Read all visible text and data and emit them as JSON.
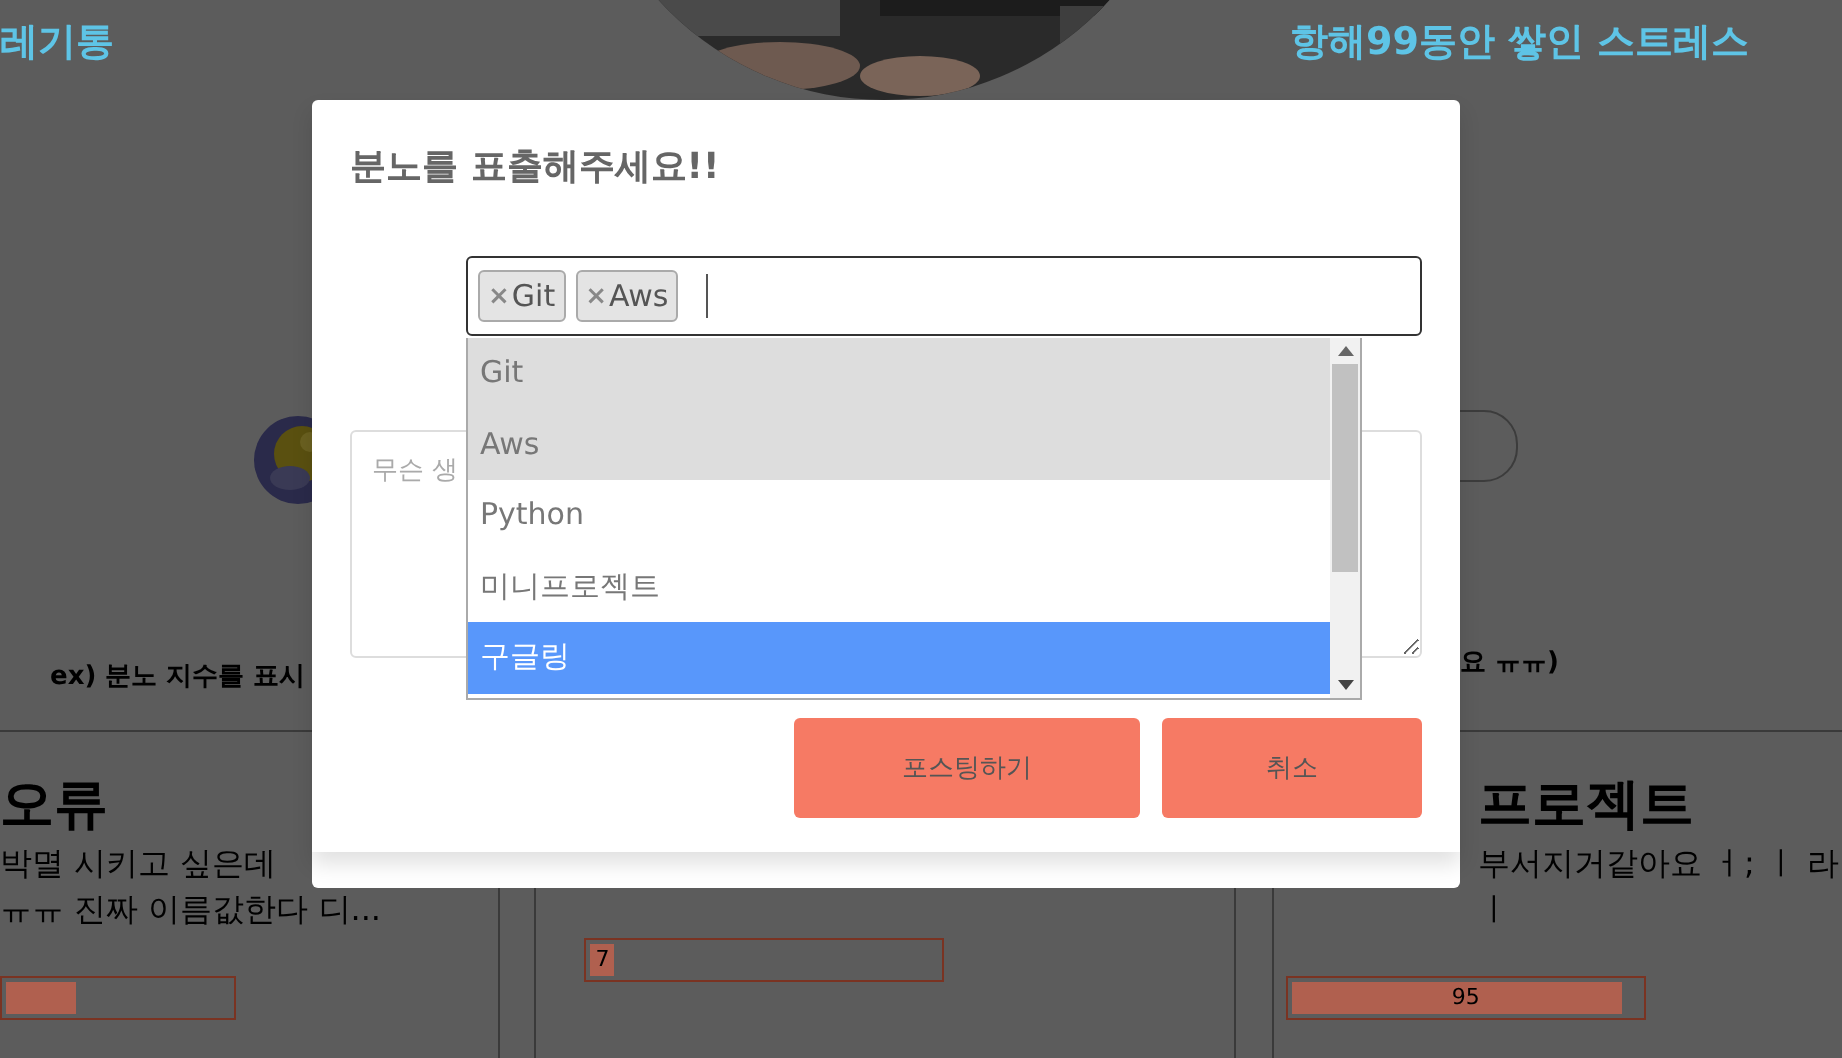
{
  "page": {
    "left_heading": "레기통",
    "right_heading": "항해99동안 쌓인 스트레스",
    "left_caption": "ex) 분노 지수를 표시",
    "right_caption": "요 ㅠㅠ)",
    "cards": [
      {
        "title": "오류",
        "lines": [
          "박멸 시키고 싶은데",
          "ㅠㅠ 진짜 이름값한다 디..."
        ],
        "level": 0.31
      },
      {
        "level": 0.07,
        "reading": "7"
      },
      {
        "title": "프로젝트",
        "lines": [
          "부서지거같아요 ㅓ; ㅣ 라",
          "ㅣ"
        ],
        "level": 0.95,
        "reading": "95"
      }
    ]
  },
  "modal": {
    "title": "분노를 표출해주세요!!",
    "tags": [
      {
        "remove": "×",
        "label": "Git"
      },
      {
        "remove": "×",
        "label": "Aws"
      }
    ],
    "options": [
      {
        "label": "Git",
        "selected": true,
        "highlighted": false
      },
      {
        "label": "Aws",
        "selected": true,
        "highlighted": false
      },
      {
        "label": "Python",
        "selected": false,
        "highlighted": false
      },
      {
        "label": "미니프로젝트",
        "selected": false,
        "highlighted": false
      },
      {
        "label": "구글링",
        "selected": false,
        "highlighted": true
      }
    ],
    "textarea": {
      "placeholder": "무슨 생"
    },
    "buttons": [
      "포스팅하기",
      "취소"
    ]
  }
}
